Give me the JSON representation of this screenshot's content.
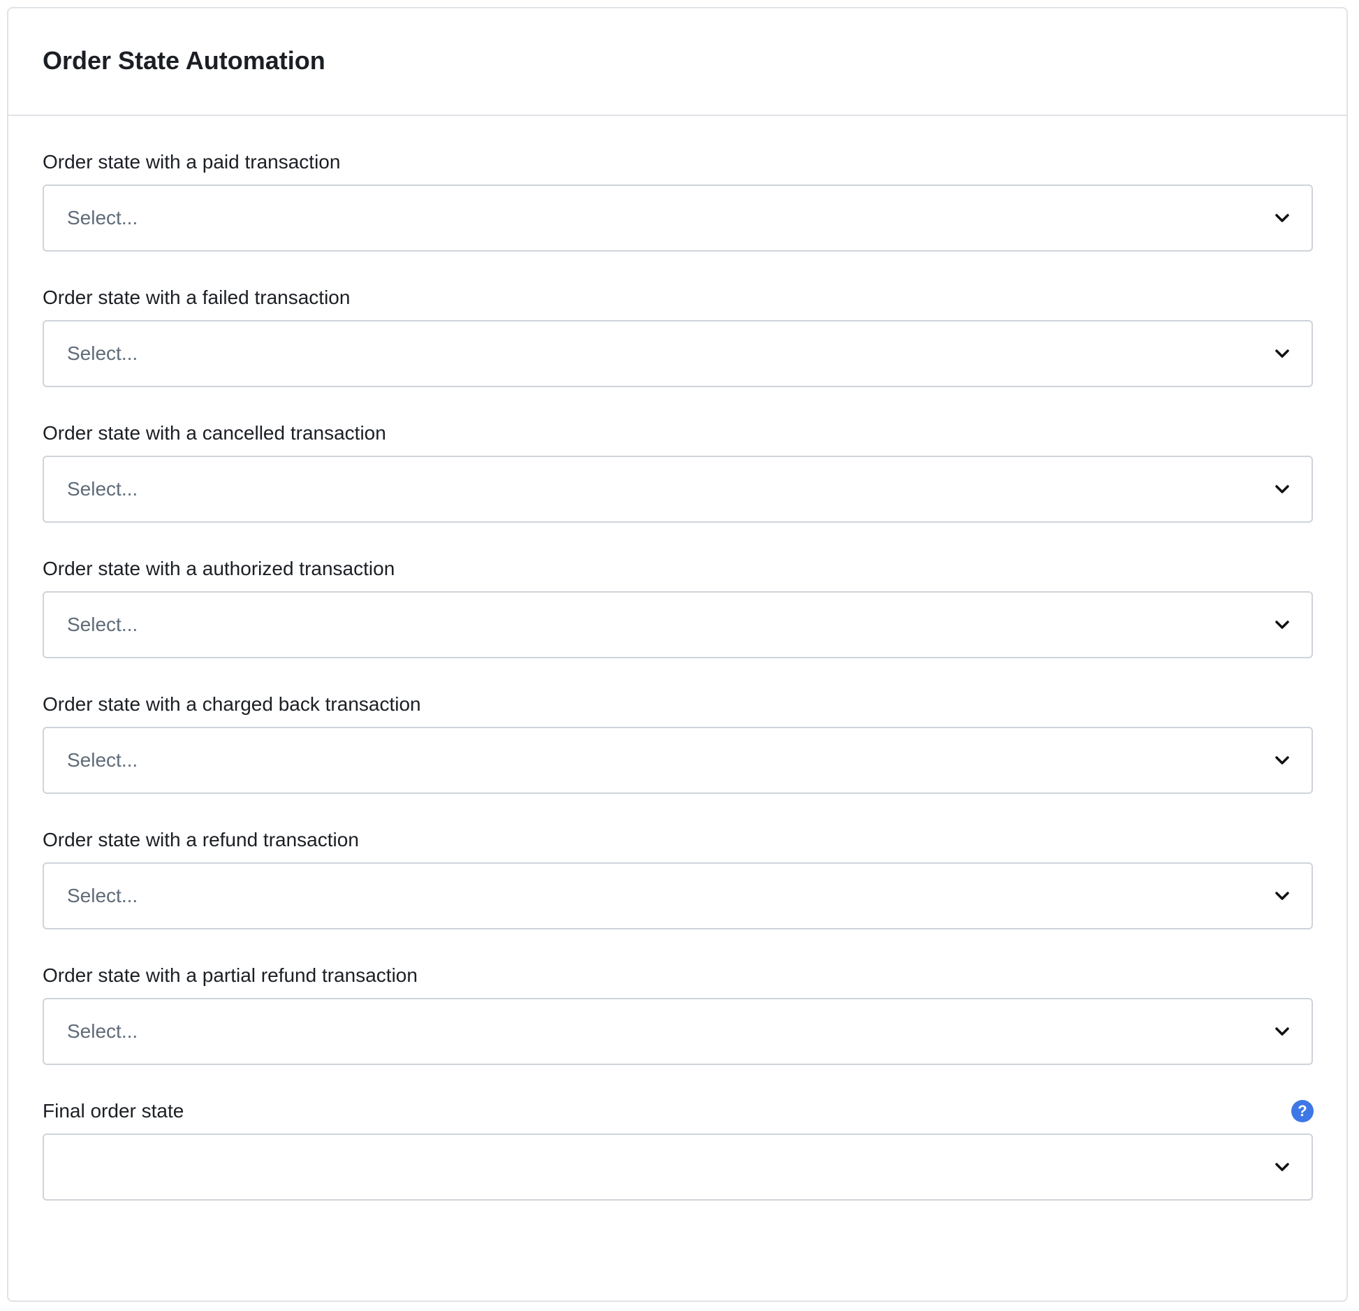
{
  "card": {
    "title": "Order State Automation"
  },
  "fields": [
    {
      "label": "Order state with a paid transaction",
      "placeholder": "Select..."
    },
    {
      "label": "Order state with a failed transaction",
      "placeholder": "Select..."
    },
    {
      "label": "Order state with a cancelled transaction",
      "placeholder": "Select..."
    },
    {
      "label": "Order state with a authorized transaction",
      "placeholder": "Select..."
    },
    {
      "label": "Order state with a charged back transaction",
      "placeholder": "Select..."
    },
    {
      "label": "Order state with a refund transaction",
      "placeholder": "Select..."
    },
    {
      "label": "Order state with a partial refund transaction",
      "placeholder": "Select..."
    },
    {
      "label": "Final order state",
      "placeholder": "",
      "help_icon": "question-mark-icon"
    }
  ],
  "colors": {
    "help_icon_bg": "#3e77e6",
    "border": "#cfd4da",
    "placeholder": "#5f6b78"
  },
  "icons": {
    "dropdown": "chevron-down-icon",
    "help": "question-mark-icon"
  }
}
